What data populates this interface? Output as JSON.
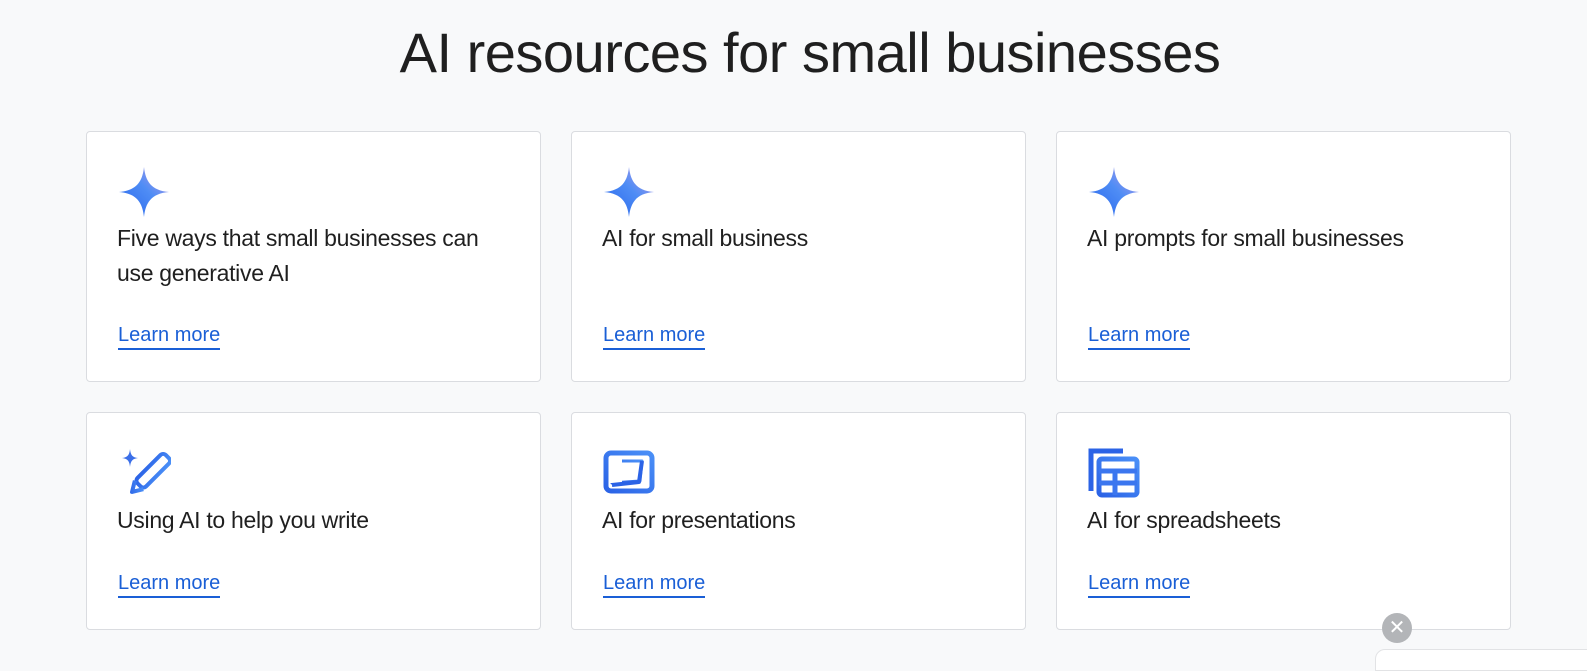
{
  "page": {
    "title": "AI resources for small businesses"
  },
  "cards": [
    {
      "title": "Five ways that small businesses can use generative AI",
      "link": "Learn more",
      "icon": "gemini-sparkle-icon"
    },
    {
      "title": "AI for small business",
      "link": "Learn more",
      "icon": "gemini-sparkle-icon"
    },
    {
      "title": "AI prompts for small businesses",
      "link": "Learn more",
      "icon": "gemini-sparkle-icon"
    },
    {
      "title": "Using AI to help you write",
      "link": "Learn more",
      "icon": "sparkle-pencil-icon"
    },
    {
      "title": "AI for presentations",
      "link": "Learn more",
      "icon": "slides-icon"
    },
    {
      "title": "AI for spreadsheets",
      "link": "Learn more",
      "icon": "sheets-icon"
    }
  ],
  "close_button": {
    "icon": "close-icon",
    "glyph": "✕"
  },
  "colors": {
    "background": "#f8f9fa",
    "link": "#1a5fd6",
    "icon_blue": "#4285f4",
    "icon_purple": "#9b72cb",
    "card_border": "#dadce0"
  }
}
